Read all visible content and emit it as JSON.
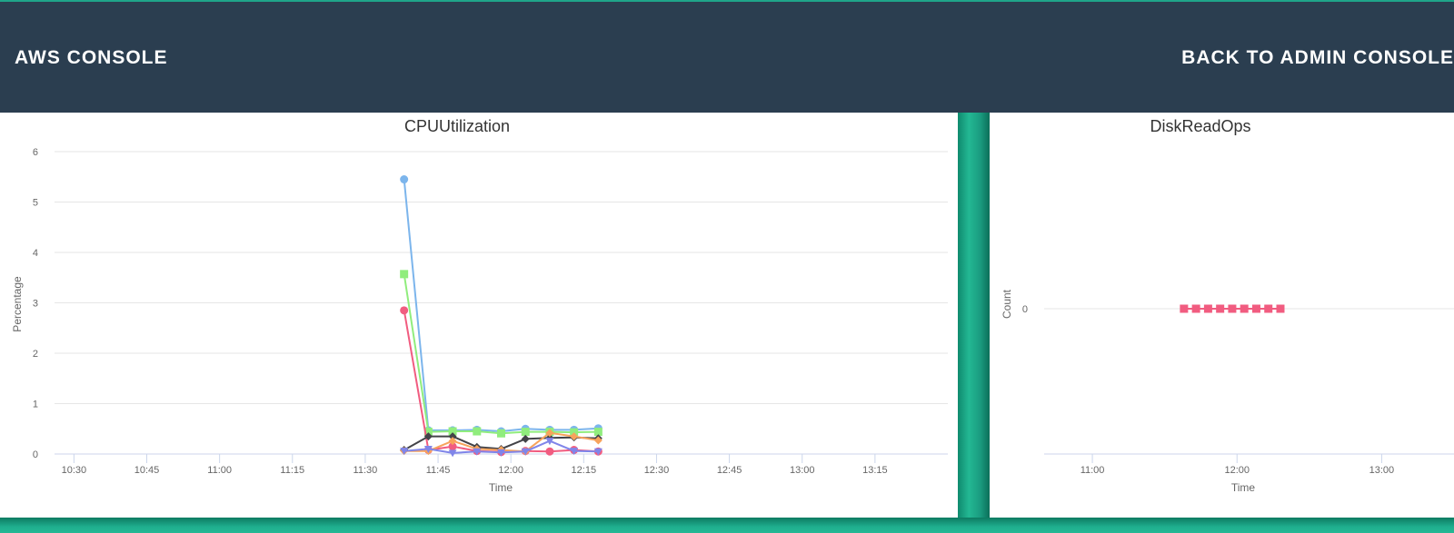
{
  "header": {
    "brand": "AWS CONSOLE",
    "back_link": "BACK TO ADMIN CONSOLE"
  },
  "colors": {
    "header_bg": "#2b3e50",
    "accent": "#1fa58a"
  },
  "chart_data": [
    {
      "type": "line",
      "title": "CPUUtilization",
      "xlabel": "Time",
      "ylabel": "Percentage",
      "x_ticks": [
        "10:30",
        "10:45",
        "11:00",
        "11:15",
        "11:30",
        "11:45",
        "12:00",
        "12:15",
        "12:30",
        "12:45",
        "13:00",
        "13:15"
      ],
      "y_ticks": [
        "0",
        "1",
        "2",
        "3",
        "4",
        "5",
        "6"
      ],
      "xlim": [
        "10:26",
        "13:30"
      ],
      "ylim": [
        0,
        6.1
      ],
      "grid": true,
      "x": [
        "11:38",
        "11:43",
        "11:48",
        "11:53",
        "11:58",
        "12:03",
        "12:08",
        "12:13",
        "12:18"
      ],
      "series": [
        {
          "color": "#7cb5ec",
          "marker": "circle",
          "values": [
            5.45,
            0.47,
            0.47,
            0.48,
            0.45,
            0.5,
            0.48,
            0.48,
            0.51
          ]
        },
        {
          "color": "#90ed7d",
          "marker": "square",
          "values": [
            3.57,
            0.44,
            0.45,
            0.45,
            0.41,
            0.44,
            0.44,
            0.43,
            0.44
          ]
        },
        {
          "color": "#f15c80",
          "marker": "circle",
          "values": [
            2.85,
            0.08,
            0.15,
            0.06,
            0.04,
            0.06,
            0.05,
            0.08,
            0.05
          ]
        },
        {
          "color": "#434348",
          "marker": "diamond",
          "values": [
            0.08,
            0.35,
            0.35,
            0.14,
            0.1,
            0.3,
            0.32,
            0.33,
            0.31
          ]
        },
        {
          "color": "#f7a35c",
          "marker": "diamond",
          "values": [
            0.06,
            0.06,
            0.26,
            0.1,
            0.08,
            0.05,
            0.42,
            0.35,
            0.27
          ]
        },
        {
          "color": "#8085e9",
          "marker": "triangle-down",
          "values": [
            0.06,
            0.1,
            0.02,
            0.05,
            0.03,
            0.05,
            0.26,
            0.06,
            0.05
          ]
        }
      ]
    },
    {
      "type": "line",
      "title": "DiskReadOps",
      "xlabel": "Time",
      "ylabel": "Count",
      "x_ticks": [
        "11:00",
        "12:00",
        "13:00"
      ],
      "y_ticks": [
        "0"
      ],
      "xlim": [
        "10:40",
        "13:30"
      ],
      "grid": true,
      "x": [
        "11:38",
        "11:43",
        "11:48",
        "11:53",
        "11:58",
        "12:03",
        "12:08",
        "12:13",
        "12:18"
      ],
      "series": [
        {
          "color": "#f15c80",
          "marker": "square",
          "values": [
            0,
            0,
            0,
            0,
            0,
            0,
            0,
            0,
            0
          ]
        }
      ]
    }
  ]
}
